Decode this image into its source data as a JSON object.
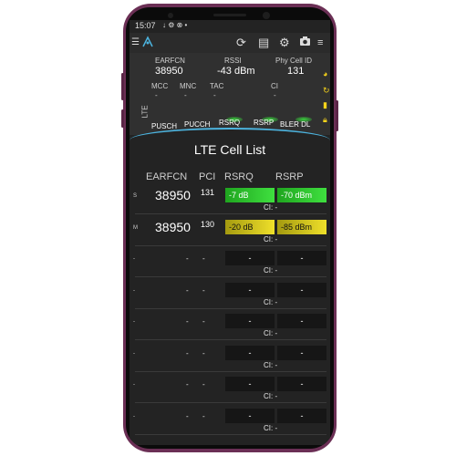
{
  "status": {
    "time": "15:07",
    "icons": "↓ ⚙ ⊗ •"
  },
  "toolbar": {
    "menu_icon": "menu-icon",
    "app_icon": "signal-app-icon",
    "refresh_icon": "refresh-icon",
    "list_icon": "list-icon",
    "settings_icon": "gear-icon",
    "camera_icon": "camera-icon",
    "filter_icon": "filter-icon"
  },
  "info": {
    "earfcn_label": "EARFCN",
    "earfcn_value": "38950",
    "rssi_label": "RSSI",
    "rssi_value": "-43 dBm",
    "phy_label": "Phy Cell ID",
    "phy_value": "131",
    "tech_label": "LTE",
    "mcc_label": "MCC",
    "mcc_value": "-",
    "mnc_label": "MNC",
    "mnc_value": "-",
    "tac_label": "TAC",
    "tac_value": "-",
    "ci_label": "CI",
    "ci_value": "-"
  },
  "tabs": [
    "PUSCH",
    "PUCCH",
    "RSRQ",
    "RSRP",
    "BLER DL"
  ],
  "page_title": "LTE Cell List",
  "columns": {
    "earfcn": "EARFCN",
    "pci": "PCI",
    "rsrq": "RSRQ",
    "rsrp": "RSRP"
  },
  "rows": [
    {
      "tag": "S",
      "earfcn": "38950",
      "pci": "131",
      "rsrq": "-7 dB",
      "rsrp": "-70 dBm",
      "ci": "CI: -"
    },
    {
      "tag": "M",
      "earfcn": "38950",
      "pci": "130",
      "rsrq": "-20 dB",
      "rsrp": "-85 dBm",
      "ci": "CI: -"
    },
    {
      "tag": "-",
      "earfcn": "-",
      "pci": "-",
      "rsrq": "-",
      "rsrp": "-",
      "ci": "CI: -"
    },
    {
      "tag": "-",
      "earfcn": "-",
      "pci": "-",
      "rsrq": "-",
      "rsrp": "-",
      "ci": "CI: -"
    },
    {
      "tag": "-",
      "earfcn": "-",
      "pci": "-",
      "rsrq": "-",
      "rsrp": "-",
      "ci": "CI: -"
    },
    {
      "tag": "-",
      "earfcn": "-",
      "pci": "-",
      "rsrq": "-",
      "rsrp": "-",
      "ci": "CI: -"
    },
    {
      "tag": "-",
      "earfcn": "-",
      "pci": "-",
      "rsrq": "-",
      "rsrp": "-",
      "ci": "CI: -"
    },
    {
      "tag": "-",
      "earfcn": "-",
      "pci": "-",
      "rsrq": "-",
      "rsrp": "-",
      "ci": "CI: -"
    }
  ],
  "colors": {
    "good": "#2ecc2e",
    "fair": "#e6d62a",
    "accent": "#4cb4df",
    "phone": "#6b2f55"
  }
}
